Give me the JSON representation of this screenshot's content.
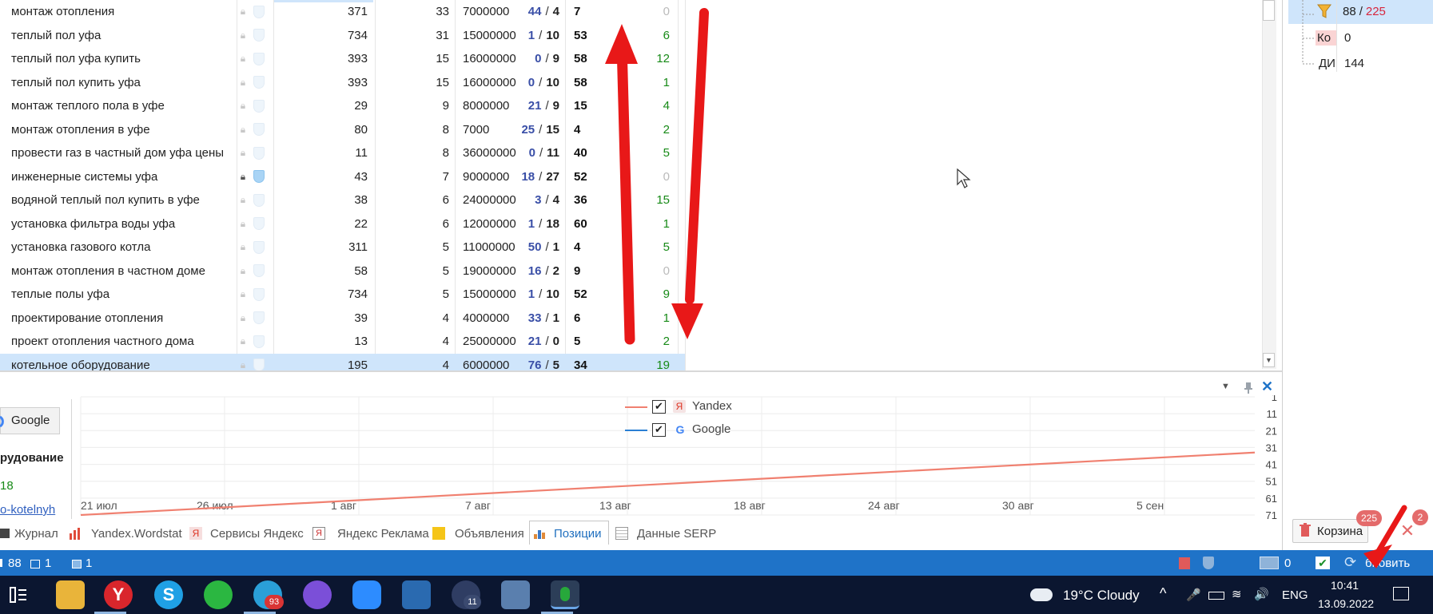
{
  "table": {
    "rows": [
      {
        "keyword": "монтаж отопления",
        "lock": "light",
        "c1": "371",
        "c2": "33",
        "c3": "7000000",
        "fa": "44",
        "fb": "4",
        "pos": "7",
        "chg": "0"
      },
      {
        "keyword": "теплый пол уфа",
        "lock": "light",
        "c1": "734",
        "c2": "31",
        "c3": "15000000",
        "fa": "1",
        "fb": "10",
        "pos": "53",
        "chg": "6"
      },
      {
        "keyword": "теплый пол уфа купить",
        "lock": "light",
        "c1": "393",
        "c2": "15",
        "c3": "16000000",
        "fa": "0",
        "fb": "9",
        "pos": "58",
        "chg": "12"
      },
      {
        "keyword": "теплый пол купить уфа",
        "lock": "light",
        "c1": "393",
        "c2": "15",
        "c3": "16000000",
        "fa": "0",
        "fb": "10",
        "pos": "58",
        "chg": "1"
      },
      {
        "keyword": "монтаж теплого пола в уфе",
        "lock": "light",
        "c1": "29",
        "c2": "9",
        "c3": "8000000",
        "fa": "21",
        "fb": "9",
        "pos": "15",
        "chg": "4"
      },
      {
        "keyword": "монтаж отопления в уфе",
        "lock": "light",
        "c1": "80",
        "c2": "8",
        "c3": "7000",
        "fa": "25",
        "fb": "15",
        "pos": "4",
        "chg": "2"
      },
      {
        "keyword": "провести газ в частный дом уфа цены",
        "lock": "light",
        "c1": "11",
        "c2": "8",
        "c3": "36000000",
        "fa": "0",
        "fb": "11",
        "pos": "40",
        "chg": "5"
      },
      {
        "keyword": "инженерные системы уфа",
        "lock": "dark",
        "c1": "43",
        "c2": "7",
        "c3": "9000000",
        "fa": "18",
        "fb": "27",
        "pos": "52",
        "chg": "0"
      },
      {
        "keyword": "водяной теплый пол купить в уфе",
        "lock": "light",
        "c1": "38",
        "c2": "6",
        "c3": "24000000",
        "fa": "3",
        "fb": "4",
        "pos": "36",
        "chg": "15"
      },
      {
        "keyword": "установка фильтра воды уфа",
        "lock": "light",
        "c1": "22",
        "c2": "6",
        "c3": "12000000",
        "fa": "1",
        "fb": "18",
        "pos": "60",
        "chg": "1"
      },
      {
        "keyword": "установка газового котла",
        "lock": "light",
        "c1": "311",
        "c2": "5",
        "c3": "11000000",
        "fa": "50",
        "fb": "1",
        "pos": "4",
        "chg": "5"
      },
      {
        "keyword": "монтаж отопления в частном доме",
        "lock": "light",
        "c1": "58",
        "c2": "5",
        "c3": "19000000",
        "fa": "16",
        "fb": "2",
        "pos": "9",
        "chg": "0"
      },
      {
        "keyword": "теплые полы уфа",
        "lock": "light",
        "c1": "734",
        "c2": "5",
        "c3": "15000000",
        "fa": "1",
        "fb": "10",
        "pos": "52",
        "chg": "9"
      },
      {
        "keyword": "проектирование отопления",
        "lock": "light",
        "c1": "39",
        "c2": "4",
        "c3": "4000000",
        "fa": "33",
        "fb": "1",
        "pos": "6",
        "chg": "1"
      },
      {
        "keyword": "проект отопления частного дома",
        "lock": "light",
        "c1": "13",
        "c2": "4",
        "c3": "25000000",
        "fa": "21",
        "fb": "0",
        "pos": "5",
        "chg": "2"
      },
      {
        "keyword": "котельное оборудование",
        "lock": "light",
        "c1": "195",
        "c2": "4",
        "c3": "6000000",
        "fa": "76",
        "fb": "5",
        "pos": "34",
        "chg": "19",
        "selected": true
      }
    ]
  },
  "right_panel": {
    "filter_count": "88",
    "filter_total": "225",
    "item2_label": "Ко",
    "item2_value": "0",
    "item3_label": "ДИ",
    "item3_value": "144",
    "trash_label": "Корзина",
    "trash_badge": "225",
    "close_badge": "2"
  },
  "chart_panel": {
    "engine_button": "Google",
    "side_label_1": "рудование",
    "side_label_2": "18",
    "side_label_3": "o-kotelnyh",
    "legend": [
      {
        "name": "Yandex",
        "color": "#f08070",
        "checked": "✔"
      },
      {
        "name": "Google",
        "color": "#2a7fd4",
        "checked": "✔"
      }
    ],
    "pin_icon": "pin-icon",
    "close_icon": "close-icon"
  },
  "chart_data": {
    "type": "line",
    "x_ticks": [
      "21 июл",
      "26 июл",
      "1 авг",
      "7 авг",
      "13 авг",
      "18 авг",
      "24 авг",
      "30 авг",
      "5 сен"
    ],
    "y_ticks": [
      "1",
      "11",
      "21",
      "31",
      "41",
      "51",
      "61",
      "71"
    ],
    "y_inverted": true,
    "ylim": [
      1,
      71
    ],
    "grid": true,
    "legend_position": "top-center",
    "series": [
      {
        "name": "Yandex",
        "color": "#f08070",
        "x": [
          "21 июл",
          "10 сен"
        ],
        "y": [
          71,
          34
        ]
      },
      {
        "name": "Google",
        "color": "#2a7fd4",
        "x": [],
        "y": []
      }
    ]
  },
  "tabs": [
    {
      "label": "Журнал",
      "active": false
    },
    {
      "label": "Yandex.Wordstat",
      "active": false
    },
    {
      "label": "Сервисы Яндекс",
      "active": false
    },
    {
      "label": "Яндекс Реклама",
      "active": false
    },
    {
      "label": "Объявления",
      "active": false
    },
    {
      "label": "Позиции",
      "active": true
    },
    {
      "label": "Данные SERP",
      "active": false
    }
  ],
  "status_bar": {
    "count_a": "88",
    "count_b": "1",
    "count_c": "1",
    "right_count": "0",
    "refresh_label": "бновить"
  },
  "taskbar": {
    "weather": "19°C  Cloudy",
    "lang": "ENG",
    "time": "10:41",
    "date": "13.09.2022",
    "telegram_badge": "93",
    "clock_app_badge": "11"
  }
}
